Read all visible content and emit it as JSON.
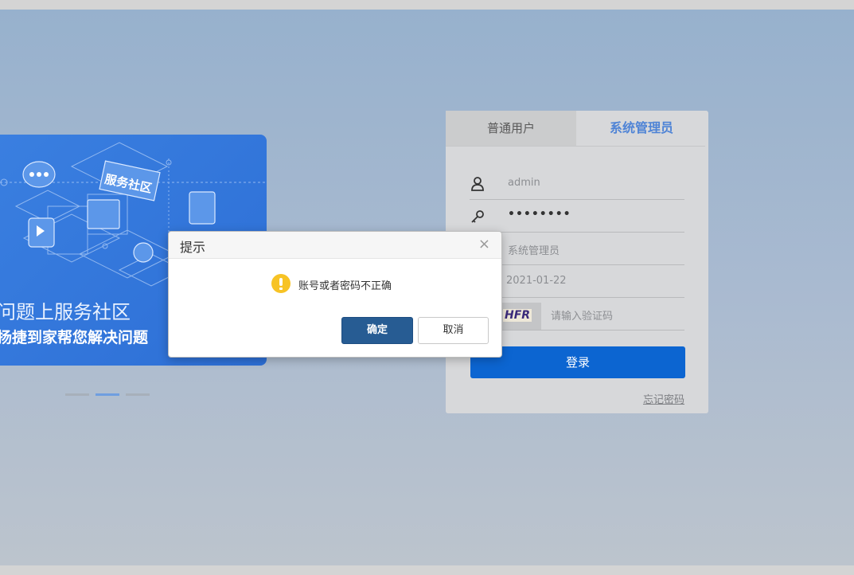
{
  "banner": {
    "illustration_label": "服务社区",
    "title": "问题上服务社区",
    "subtitle": "扬捷到家帮您解决问题",
    "carousel_dots": 3,
    "active_dot": 1
  },
  "login": {
    "tabs": [
      {
        "label": "普通用户",
        "active": false
      },
      {
        "label": "系统管理员",
        "active": true
      }
    ],
    "fields": {
      "username": {
        "value": "admin",
        "icon": "user-icon"
      },
      "password": {
        "value": "••••••••",
        "icon": "key-icon"
      },
      "role": {
        "value": "系统管理员"
      },
      "date": {
        "value": "2021-01-22"
      },
      "captcha": {
        "image_text": "HFR",
        "placeholder": "请输入验证码"
      }
    },
    "submit_label": "登录",
    "forgot_label": "忘记密码"
  },
  "dialog": {
    "title": "提示",
    "close_glyph": "×",
    "message": "账号或者密码不正确",
    "icon": "warning-icon",
    "ok_label": "确定",
    "cancel_label": "取消"
  },
  "colors": {
    "primary": "#0c65d1",
    "admin_tab": "#4f84d6",
    "ok_button": "#275c93",
    "warning": "#f7c325",
    "banner": "#2d6fd6"
  }
}
